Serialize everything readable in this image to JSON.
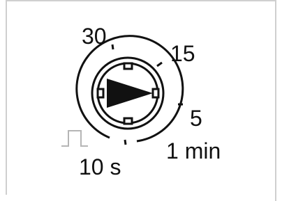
{
  "dial": {
    "labels": {
      "l30": "30",
      "l15": "15",
      "l5": "5",
      "l1min": "1 min",
      "l10s": "10 s"
    }
  },
  "icons": {
    "pulse": "pulse-icon",
    "pointer": "pointer-arrow-icon"
  },
  "colors": {
    "ink": "#111111",
    "pulse": "#b5b5b5",
    "frame": "#cfcfcf"
  }
}
